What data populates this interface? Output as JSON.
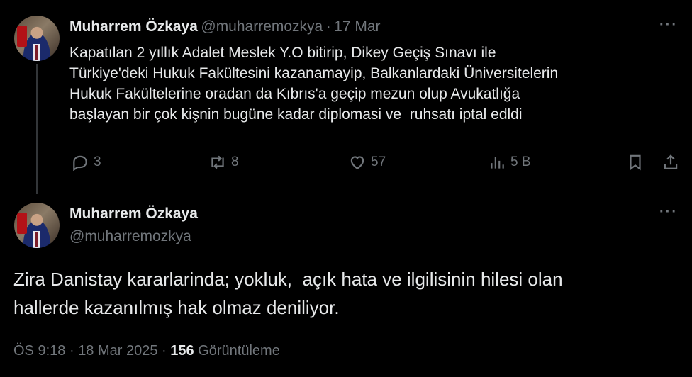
{
  "tweet1": {
    "author_name": "Muharrem Özkaya",
    "handle": "@muharremozkya",
    "separator": "·",
    "date": "17 Mar",
    "text": "Kapatılan 2 yıllık Adalet Meslek Y.O bitirip, Dikey Geçiş Sınavı ile\nTürkiye'deki Hukuk Fakültesini kazanamayip, Balkanlardaki Üniversitelerin\nHukuk Fakültelerine oradan da Kıbrıs'a geçip mezun olup Avukatlığa\nbaşlayan bir çok kişnin bugüne kadar diplomasi ve  ruhsatı iptal edldi",
    "more": "···",
    "replies": "3",
    "reposts": "8",
    "likes": "57",
    "views": "5 B"
  },
  "tweet2": {
    "author_name": "Muharrem Özkaya",
    "handle": "@muharremozkya",
    "more": "···",
    "text": "Zira Danistay kararlarinda; yokluk,  açık hata ve ilgilisinin hilesi olan\nhallerde kazanılmış hak olmaz deniliyor.",
    "time": "ÖS 9:18",
    "separator1": "·",
    "date": "18 Mar 2025",
    "separator2": "·",
    "view_count": "156",
    "view_label": "Görüntüleme"
  },
  "icons": {
    "reply": "reply-icon",
    "repost": "repost-icon",
    "like": "heart-icon",
    "views": "analytics-icon",
    "bookmark": "bookmark-icon",
    "share": "share-icon"
  },
  "colors": {
    "background": "#000000",
    "text": "#e7e9ea",
    "secondary": "#71767b",
    "thread_line": "#333639"
  }
}
